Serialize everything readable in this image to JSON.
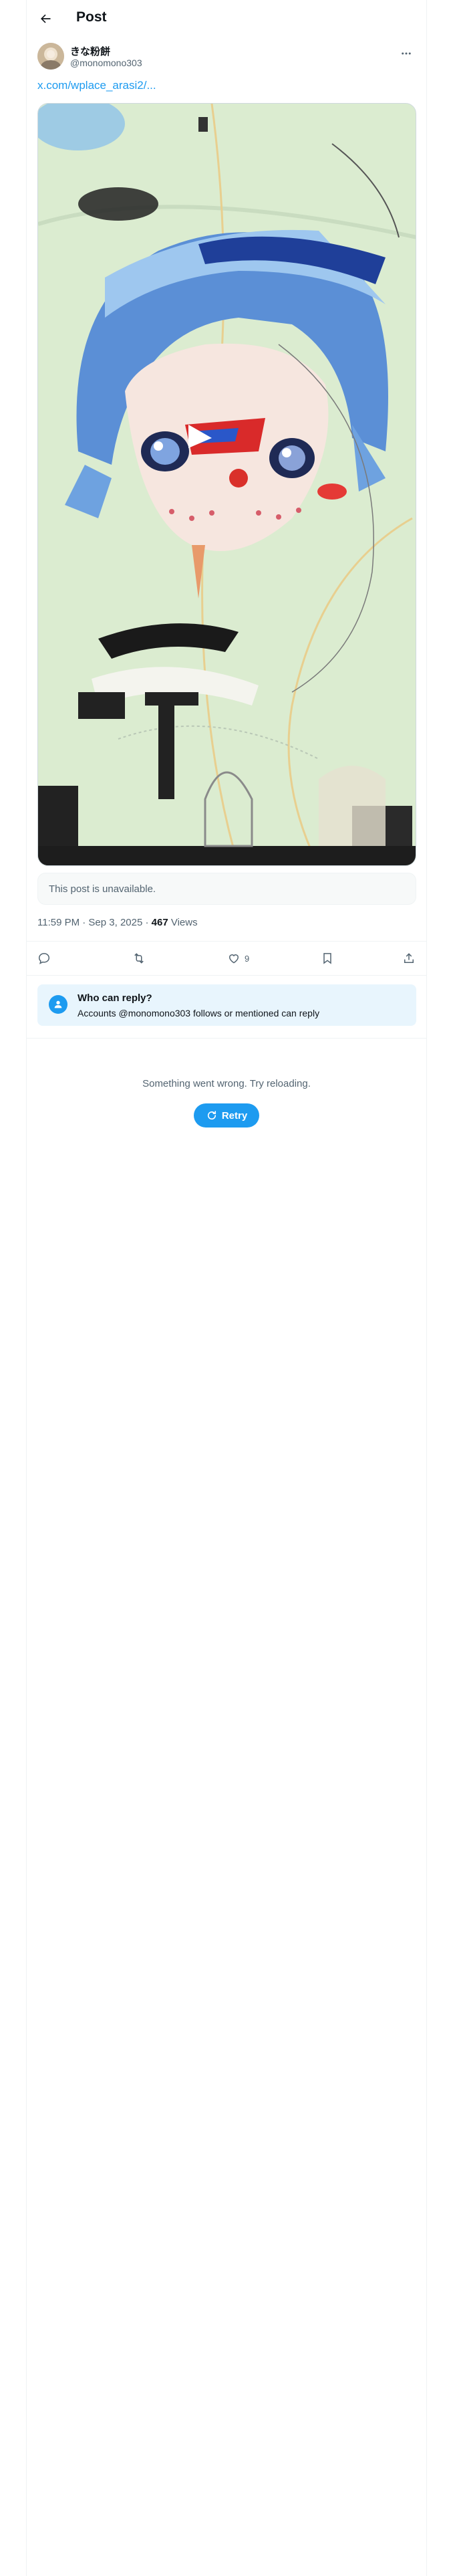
{
  "header": {
    "title": "Post"
  },
  "author": {
    "display_name": "きな粉餅",
    "handle": "@monomono303"
  },
  "post": {
    "link_text": "x.com/wplace_arasi2/..."
  },
  "quote": {
    "text": "This post is unavailable."
  },
  "meta": {
    "timestamp": "11:59 PM · Sep 3, 2025 · ",
    "views_count": "467",
    "views_label": " Views"
  },
  "actions": {
    "like_count": "9"
  },
  "reply_settings": {
    "title": "Who can reply?",
    "subtitle": "Accounts @monomono303 follows or mentioned can reply"
  },
  "replies": {
    "error_text": "Something went wrong. Try reloading.",
    "retry_label": "Retry"
  },
  "colors": {
    "accent": "#1d9bf0",
    "text_primary": "#0f1419",
    "text_secondary": "#536471",
    "border": "#eff3f4"
  },
  "icons": [
    "back-arrow-icon",
    "more-dots-icon",
    "reply-icon",
    "repost-icon",
    "like-icon",
    "bookmark-icon",
    "share-icon",
    "person-icon",
    "refresh-icon"
  ]
}
